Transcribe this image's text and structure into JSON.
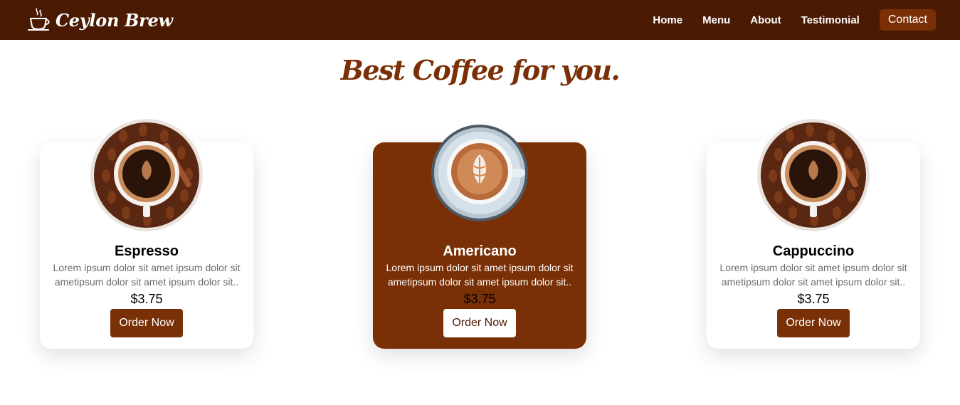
{
  "navbar": {
    "brand": "Ceylon Brew",
    "logo_icon": "coffee-cup-icon",
    "links": [
      "Home",
      "Menu",
      "About",
      "Testimonial"
    ],
    "contact_label": "Contact"
  },
  "section": {
    "heading": "Best Coffee for you."
  },
  "products": [
    {
      "name": "Espresso",
      "description": "Lorem ipsum dolor sit amet ipsum dolor sit ametipsum dolor sit amet ipsum dolor sit..",
      "price": "$3.75",
      "button": "Order Now",
      "image_icon": "coffee-beans-cup-image"
    },
    {
      "name": "Americano",
      "description": "Lorem ipsum dolor sit amet ipsum dolor sit ametipsum dolor sit amet ipsum dolor sit..",
      "price": "$3.75",
      "button": "Order Now",
      "image_icon": "latte-art-cup-image"
    },
    {
      "name": "Cappuccino",
      "description": "Lorem ipsum dolor sit amet ipsum dolor sit ametipsum dolor sit amet ipsum dolor sit..",
      "price": "$3.75",
      "button": "Order Now",
      "image_icon": "coffee-beans-cup-image"
    }
  ],
  "colors": {
    "navbar_bg": "#4a1a02",
    "accent": "#7a3006",
    "card_bg": "#ffffff"
  }
}
